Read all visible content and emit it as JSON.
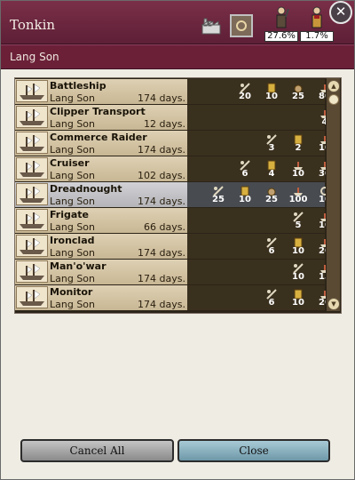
{
  "window": {
    "title": "Tonkin",
    "subtitle": "Lang Son",
    "close_glyph": "✕",
    "stats": [
      {
        "icon": "soldier-icon",
        "value": "27.6%"
      },
      {
        "icon": "officer-icon",
        "value": "1.7%"
      }
    ]
  },
  "units": [
    {
      "name": "Battleship",
      "location": "Lang Son",
      "days": "174 days.",
      "stats": [
        {
          "slot": 1,
          "icon": "attack-icon",
          "value": "20"
        },
        {
          "slot": 2,
          "icon": "hull-icon",
          "value": "10"
        },
        {
          "slot": 3,
          "icon": "supply-icon",
          "value": "25"
        },
        {
          "slot": 4,
          "icon": "ship-icon",
          "value": "80"
        }
      ]
    },
    {
      "name": "Clipper Transport",
      "location": "Lang Son",
      "days": "12 days.",
      "stats": [
        {
          "slot": 4,
          "icon": "ship-icon",
          "value": "4"
        }
      ]
    },
    {
      "name": "Commerce Raider",
      "location": "Lang Son",
      "days": "174 days.",
      "stats": [
        {
          "slot": 2,
          "icon": "attack-icon",
          "value": "3"
        },
        {
          "slot": 3,
          "icon": "hull-icon",
          "value": "2"
        },
        {
          "slot": 4,
          "icon": "ship-icon",
          "value": "10"
        }
      ]
    },
    {
      "name": "Cruiser",
      "location": "Lang Son",
      "days": "102 days.",
      "stats": [
        {
          "slot": 1,
          "icon": "attack-icon",
          "value": "6"
        },
        {
          "slot": 2,
          "icon": "hull-icon",
          "value": "4"
        },
        {
          "slot": 3,
          "icon": "ship-icon",
          "value": "10"
        },
        {
          "slot": 4,
          "icon": "ship-icon",
          "value": "30"
        }
      ]
    },
    {
      "name": "Dreadnought",
      "location": "Lang Son",
      "days": "174 days.",
      "stats": [
        {
          "slot": 0,
          "icon": "attack-icon",
          "value": "25"
        },
        {
          "slot": 1,
          "icon": "hull-icon",
          "value": "10"
        },
        {
          "slot": 2,
          "icon": "supply-icon",
          "value": "25"
        },
        {
          "slot": 3,
          "icon": "ship-icon",
          "value": "100"
        },
        {
          "slot": 4,
          "icon": "gear-icon",
          "value": "10"
        }
      ]
    },
    {
      "name": "Frigate",
      "location": "Lang Son",
      "days": "66 days.",
      "stats": [
        {
          "slot": 3,
          "icon": "attack-icon",
          "value": "5"
        },
        {
          "slot": 4,
          "icon": "ship-icon",
          "value": "10"
        }
      ]
    },
    {
      "name": "Ironclad",
      "location": "Lang Son",
      "days": "174 days.",
      "stats": [
        {
          "slot": 2,
          "icon": "attack-icon",
          "value": "6"
        },
        {
          "slot": 3,
          "icon": "hull-icon",
          "value": "10"
        },
        {
          "slot": 4,
          "icon": "ship-icon",
          "value": "20"
        }
      ]
    },
    {
      "name": "Man'o'war",
      "location": "Lang Son",
      "days": "174 days.",
      "stats": [
        {
          "slot": 3,
          "icon": "attack-icon",
          "value": "10"
        },
        {
          "slot": 4,
          "icon": "ship-icon",
          "value": "15"
        }
      ]
    },
    {
      "name": "Monitor",
      "location": "Lang Son",
      "days": "174 days.",
      "stats": [
        {
          "slot": 2,
          "icon": "attack-icon",
          "value": "6"
        },
        {
          "slot": 3,
          "icon": "hull-icon",
          "value": "10"
        },
        {
          "slot": 4,
          "icon": "ship-icon",
          "value": "20"
        }
      ]
    }
  ],
  "selected_index": 4,
  "buttons": {
    "cancel_all": "Cancel All",
    "close": "Close"
  },
  "colors": {
    "title_bar": "#6b2038",
    "selected_row": "#b4b4b8",
    "close_button": "#8fb8c6"
  }
}
